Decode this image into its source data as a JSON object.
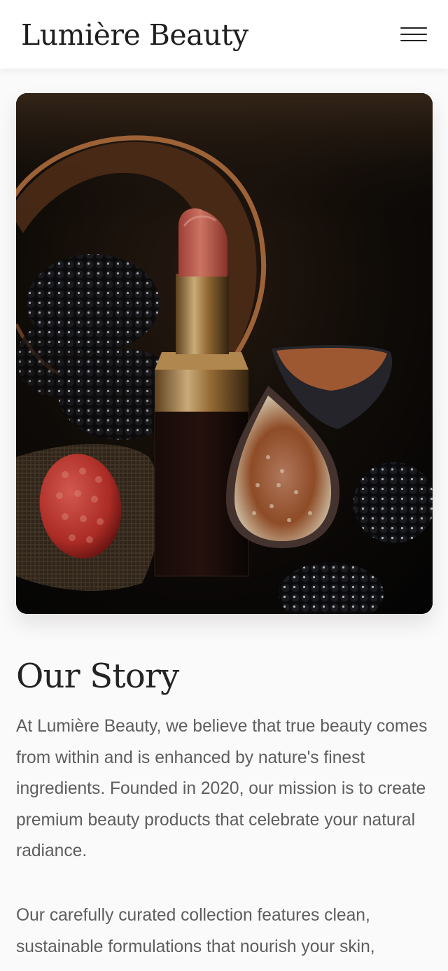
{
  "header": {
    "brand": "Lumière Beauty",
    "menu_icon": "hamburger-menu-icon"
  },
  "hero": {
    "image_alt": "Lipstick with figs, raspberry and blackberries on a dark background"
  },
  "story": {
    "title": "Our Story",
    "paragraphs": [
      "At Lumière Beauty, we believe that true beauty comes from within and is enhanced by nature's finest ingredients. Founded in 2020, our mission is to create premium beauty products that celebrate your natural radiance.",
      "Our carefully curated collection features clean, sustainable formulations that nourish your skin,"
    ]
  },
  "colors": {
    "background": "#fbfafa",
    "heading": "#232323",
    "body_text": "#5d5d5d",
    "header_bg": "#ffffff"
  }
}
